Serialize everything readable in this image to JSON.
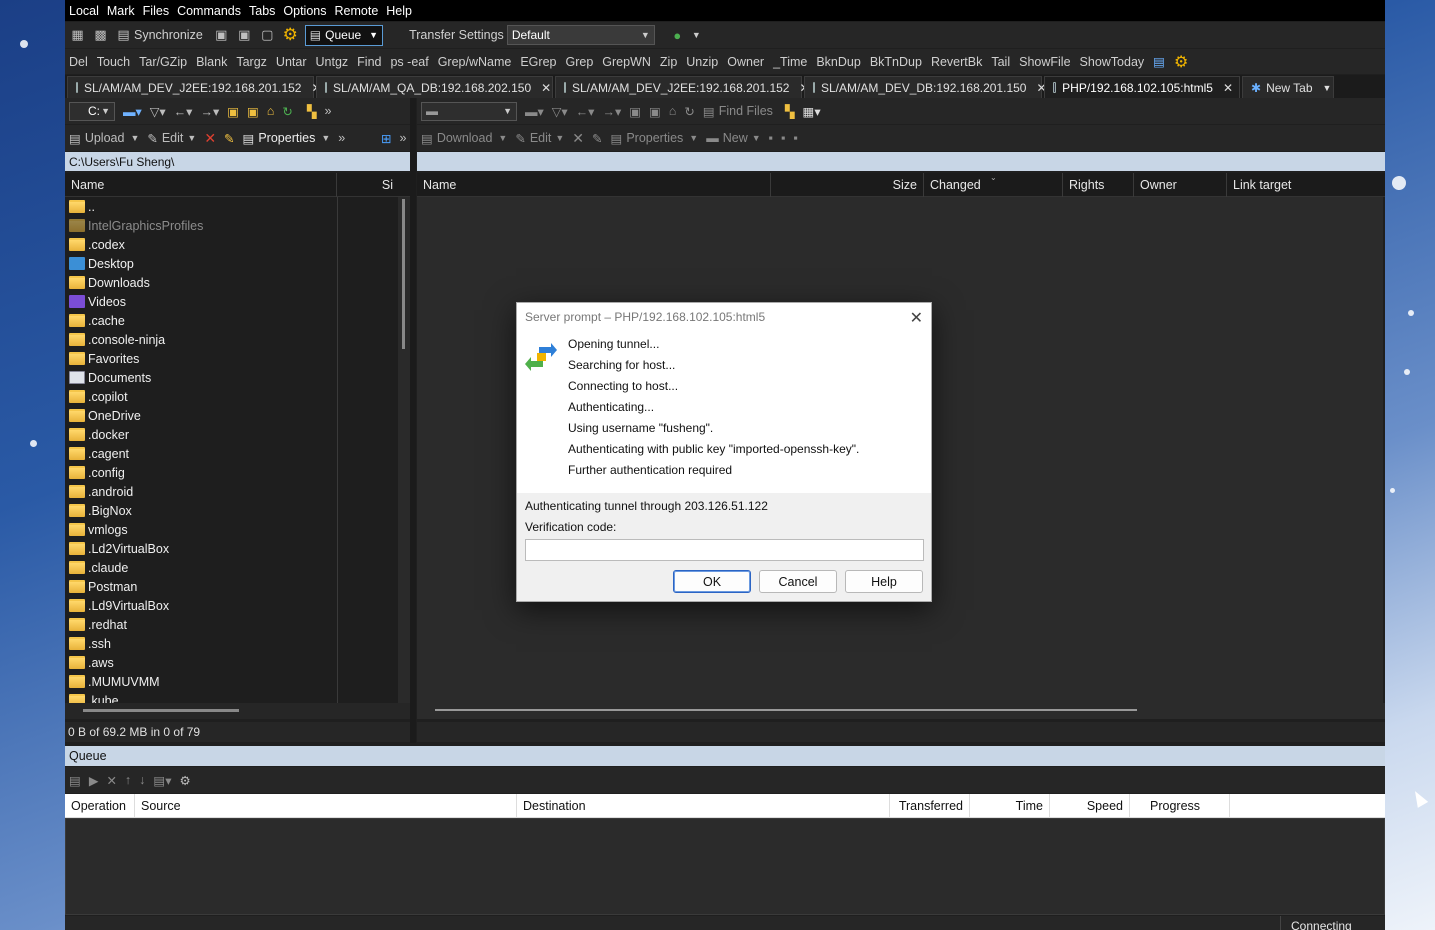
{
  "menu": [
    "Local",
    "Mark",
    "Files",
    "Commands",
    "Tabs",
    "Options",
    "Remote",
    "Help"
  ],
  "toolbar1": {
    "synchronize": "Synchronize",
    "queue": "Queue",
    "transfer_settings_label": "Transfer Settings",
    "transfer_settings_value": "Default"
  },
  "custom_commands": [
    "Del",
    "Touch",
    "Tar/GZip",
    "Blank",
    "Targz",
    "Untar",
    "Untgz",
    "Find",
    "ps -eaf",
    "Grep/wName",
    "EGrep",
    "Grep",
    "GrepWN",
    "Zip",
    "Unzip",
    "Owner",
    "_Time",
    "BknDup",
    "BkTnDup",
    "RevertBk",
    "Tail",
    "ShowFile",
    "ShowToday"
  ],
  "tabs": [
    {
      "label": "SL/AM/AM_DEV_J2EE:192.168.201.152"
    },
    {
      "label": "SL/AM/AM_QA_DB:192.168.202.150"
    },
    {
      "label": "SL/AM/AM_DEV_J2EE:192.168.201.152"
    },
    {
      "label": "SL/AM/AM_DEV_DB:192.168.201.150"
    },
    {
      "label": "PHP/192.168.102.105:html5"
    }
  ],
  "new_tab": "New Tab",
  "local": {
    "drive": "C:",
    "upload": "Upload",
    "edit": "Edit",
    "properties": "Properties",
    "path": "C:\\Users\\Fu Sheng\\",
    "columns": [
      "Name",
      "Si"
    ],
    "files": [
      {
        "name": "..",
        "icon": "folder-up-icon"
      },
      {
        "name": "IntelGraphicsProfiles",
        "icon": "folder-icon",
        "dim": true
      },
      {
        "name": ".codex",
        "icon": "folder-icon"
      },
      {
        "name": "Desktop",
        "icon": "desktop-icon"
      },
      {
        "name": "Downloads",
        "icon": "folder-icon"
      },
      {
        "name": "Videos",
        "icon": "video-icon"
      },
      {
        "name": ".cache",
        "icon": "folder-icon"
      },
      {
        "name": ".console-ninja",
        "icon": "folder-icon"
      },
      {
        "name": "Favorites",
        "icon": "folder-icon"
      },
      {
        "name": "Documents",
        "icon": "documents-icon"
      },
      {
        "name": ".copilot",
        "icon": "folder-icon"
      },
      {
        "name": "OneDrive",
        "icon": "folder-icon"
      },
      {
        "name": ".docker",
        "icon": "folder-icon"
      },
      {
        "name": ".cagent",
        "icon": "folder-icon"
      },
      {
        "name": ".config",
        "icon": "folder-icon"
      },
      {
        "name": ".android",
        "icon": "folder-icon"
      },
      {
        "name": ".BigNox",
        "icon": "folder-icon"
      },
      {
        "name": "vmlogs",
        "icon": "folder-icon"
      },
      {
        "name": ".Ld2VirtualBox",
        "icon": "folder-icon"
      },
      {
        "name": ".claude",
        "icon": "folder-icon"
      },
      {
        "name": "Postman",
        "icon": "folder-icon"
      },
      {
        "name": ".Ld9VirtualBox",
        "icon": "folder-icon"
      },
      {
        "name": ".redhat",
        "icon": "folder-icon"
      },
      {
        "name": ".ssh",
        "icon": "folder-icon"
      },
      {
        "name": ".aws",
        "icon": "folder-icon"
      },
      {
        "name": ".MUMUVMM",
        "icon": "folder-icon"
      },
      {
        "name": ".kube",
        "icon": "folder-icon"
      }
    ],
    "status": "0 B of 69.2 MB in 0 of 79"
  },
  "remote": {
    "find_files": "Find Files",
    "download": "Download",
    "edit": "Edit",
    "properties": "Properties",
    "new": "New",
    "columns": [
      "Name",
      "Size",
      "Changed",
      "Rights",
      "Owner",
      "Link target"
    ]
  },
  "dialog": {
    "title": "Server prompt – PHP/192.168.102.105:html5",
    "log": [
      "Opening tunnel...",
      "Searching for host...",
      "Connecting to host...",
      "Authenticating...",
      "Using username \"fusheng\".",
      "Authenticating with public key \"imported-openssh-key\".",
      "Further authentication required"
    ],
    "tunnel_text": "Authenticating tunnel through 203.126.51.122",
    "verification_label": "Verification code:",
    "verification_value": "",
    "ok": "OK",
    "cancel": "Cancel",
    "help": "Help"
  },
  "queue": {
    "title": "Queue",
    "columns": [
      "Operation",
      "Source",
      "Destination",
      "Transferred",
      "Time",
      "Speed",
      "Progress"
    ]
  },
  "statusbar": {
    "connection": "Connecting"
  }
}
